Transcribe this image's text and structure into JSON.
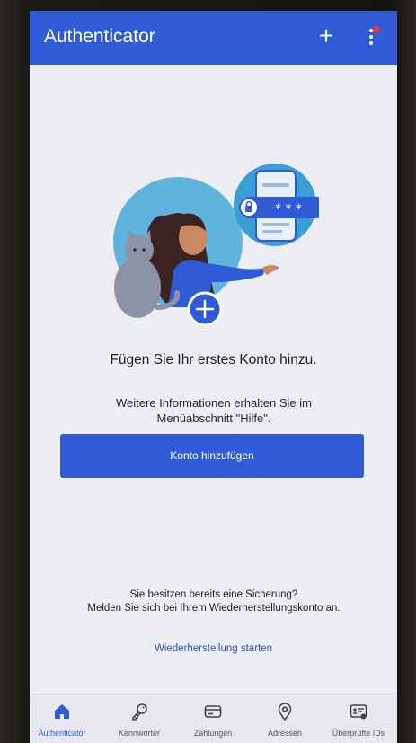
{
  "app_bar": {
    "title": "Authenticator",
    "add_icon": "plus-icon",
    "more_icon": "more-vert-icon",
    "badge_color": "#e03a3a"
  },
  "main": {
    "headline": "Fügen Sie Ihr erstes Konto hinzu.",
    "info_line1": "Weitere Informationen erhalten Sie im",
    "info_line2": "Menüabschnitt \"Hilfe\".",
    "add_account_button": "Konto hinzufügen",
    "backup_line1": "Sie besitzen bereits eine Sicherung?",
    "backup_line2": "Melden Sie sich bei Ihrem Wiederherstellungskonto an.",
    "restore_link": "Wiederherstellung starten",
    "password_mask": "* * *"
  },
  "bottom_nav": {
    "items": [
      {
        "label": "Authenticator",
        "icon": "home-icon",
        "active": true
      },
      {
        "label": "Kennwörter",
        "icon": "key-icon",
        "active": false
      },
      {
        "label": "Zahlungen",
        "icon": "credit-card-icon",
        "active": false
      },
      {
        "label": "Adressen",
        "icon": "location-pin-icon",
        "active": false
      },
      {
        "label": "Überprüfte IDs",
        "icon": "id-card-icon",
        "active": false
      }
    ]
  },
  "colors": {
    "accent": "#2f5bd6",
    "background": "#eceef3",
    "link": "#2f4fb5"
  }
}
